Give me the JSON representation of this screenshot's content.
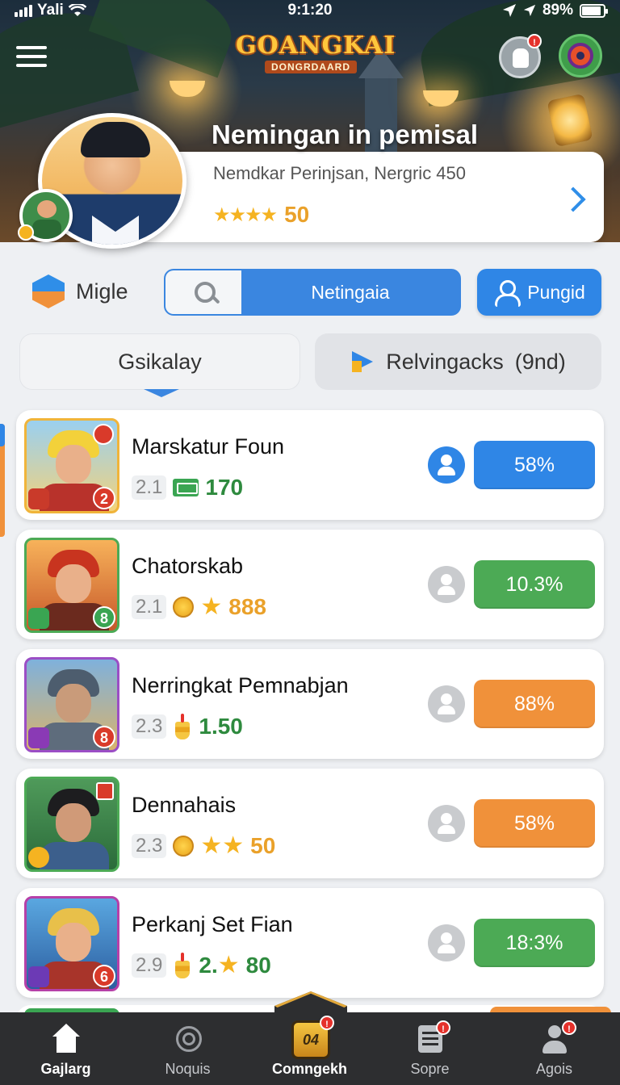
{
  "status_bar": {
    "carrier": "Yali",
    "time": "9:1:20",
    "battery": "89%"
  },
  "header": {
    "logo_title": "GOANGKAI",
    "logo_subtitle": "DONGRDAARD",
    "notification_badge": "!"
  },
  "profile": {
    "name": "Nemingan in pemisal",
    "subtitle": "Nemdkar Perinjsan, Nergric 450",
    "stars": "★★★★",
    "rating": "50"
  },
  "toolbar": {
    "mode_label": "Migle",
    "search_value": "Netingaia",
    "people_button": "Pungid"
  },
  "tabs": [
    {
      "label": "Gsikalay"
    },
    {
      "label": "Relvingacks",
      "count": "(9nd)"
    }
  ],
  "rows": [
    {
      "name": "Marskatur Foun",
      "rank": "2.1",
      "score": "170",
      "percent": "58%",
      "level": "2",
      "accent": "#2f86e6",
      "score_color": "#2e8a3e",
      "user_color": "#2f86e6"
    },
    {
      "name": "Chatorskab",
      "rank": "2.1",
      "score": "888",
      "percent": "10.3%",
      "level": "8",
      "accent": "#4caa55",
      "score_color": "#eaa12a",
      "user_color": "#c9cbce"
    },
    {
      "name": "Nerringkat Pemnabjan",
      "rank": "2.3",
      "score": "1.50",
      "percent": "88%",
      "level": "8",
      "accent": "#f0913a",
      "score_color": "#2e8a3e",
      "user_color": "#c9cbce"
    },
    {
      "name": "Dennahais",
      "rank": "2.3",
      "score": "50",
      "percent": "58%",
      "level": "",
      "accent": "#f0913a",
      "score_color": "#eaa12a",
      "user_color": "#c9cbce"
    },
    {
      "name": "Perkanj Set Fian",
      "rank": "2.9",
      "score_prefix": "2.",
      "score": "80",
      "percent": "18:3%",
      "level": "6",
      "accent": "#4caa55",
      "score_color": "#2e8a3e",
      "user_color": "#c9cbce"
    }
  ],
  "bottom_nav": [
    {
      "label": "Gajlarg",
      "icon": "home-icon"
    },
    {
      "label": "Noquis",
      "icon": "search-icon"
    },
    {
      "label": "Comngekh",
      "icon": "trophy-icon",
      "badge": "!",
      "emblem": "04"
    },
    {
      "label": "Sopre",
      "icon": "list-icon",
      "badge": "!"
    },
    {
      "label": "Agois",
      "icon": "user-icon",
      "badge": "!"
    }
  ],
  "colors": {
    "primary_blue": "#2f86e6",
    "success_green": "#4caa55",
    "warning_orange": "#f0913a",
    "star_gold": "#f5b321",
    "nav_bg": "#2d2e30"
  }
}
